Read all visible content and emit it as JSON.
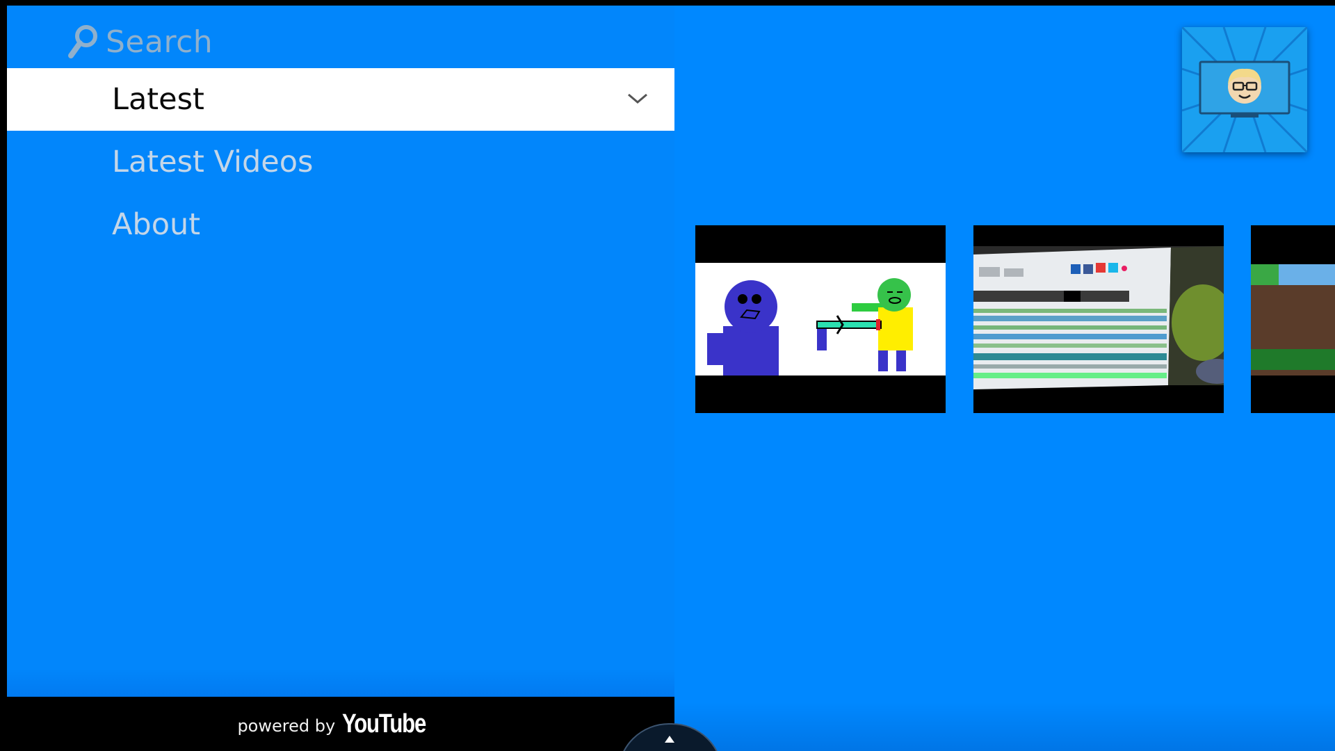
{
  "search": {
    "placeholder": "Search",
    "icon": "search-icon"
  },
  "menu": {
    "items": [
      {
        "label": "Latest",
        "selected": true,
        "icon": "chevron-down-icon"
      },
      {
        "label": "Latest Videos",
        "selected": false
      },
      {
        "label": "About",
        "selected": false
      }
    ]
  },
  "footer": {
    "powered_label": "powered by",
    "brand": "YouTube"
  },
  "colors": {
    "background": "#0088ff",
    "selected_bg": "#ffffff",
    "footer_bg": "#000000"
  },
  "videos": [
    {
      "name": "video-thumbnail-animation"
    },
    {
      "name": "video-thumbnail-editing-screen"
    },
    {
      "name": "video-thumbnail-partial"
    }
  ]
}
